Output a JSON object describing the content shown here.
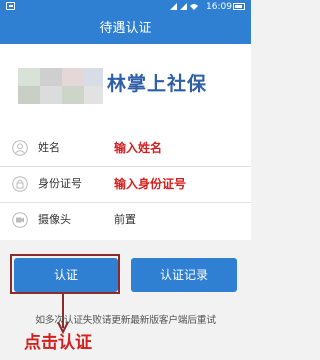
{
  "status_bar": {
    "time": "16:09"
  },
  "nav": {
    "title": "待遇认证"
  },
  "logo": {
    "text": "林掌上社保"
  },
  "form": {
    "name_label": "姓名",
    "id_label": "身份证号",
    "camera_label": "摄像头",
    "camera_value": "前置"
  },
  "annotations": {
    "name_hint": "输入姓名",
    "id_hint": "输入身份证号",
    "click_hint": "点击认证",
    "highlight_color": "#d61f1f"
  },
  "buttons": {
    "verify_label": "认证",
    "record_label": "认证记录"
  },
  "tip": "如多次认证失败请更新最新版客户端后重试",
  "colors": {
    "primary": "#2f7fd2",
    "background": "#f2f2f2"
  }
}
